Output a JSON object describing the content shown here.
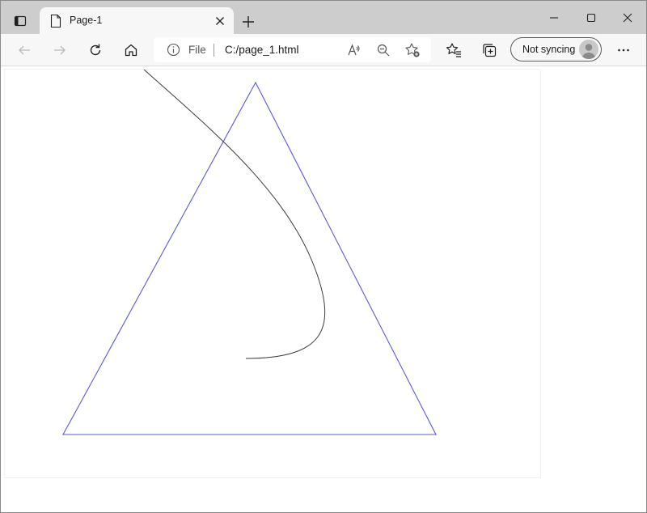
{
  "tab": {
    "title": "Page-1",
    "favicon": "page-icon"
  },
  "address": {
    "scheme_label": "File",
    "url": "C:/page_1.html"
  },
  "profile": {
    "label": "Not syncing"
  },
  "icons": {
    "tab_actions": "tab-actions-icon",
    "close_tab": "close-icon",
    "new_tab": "plus-icon",
    "minimize": "minimize-icon",
    "maximize": "maximize-icon",
    "close_window": "close-icon",
    "back": "back-arrow-icon",
    "forward": "forward-arrow-icon",
    "refresh": "refresh-icon",
    "home": "home-icon",
    "info": "info-icon",
    "read_aloud": "read-aloud-icon",
    "zoom_out": "zoom-out-icon",
    "add_favorite": "add-favorite-icon",
    "favorites": "favorites-icon",
    "collections": "collections-icon",
    "more": "more-icon"
  },
  "colors": {
    "triangle_stroke": "#5a5ad2",
    "curve_stroke": "#3a3a3a",
    "tabstrip_bg": "#cdcdcd",
    "toolbar_bg": "#f7f7f7"
  }
}
